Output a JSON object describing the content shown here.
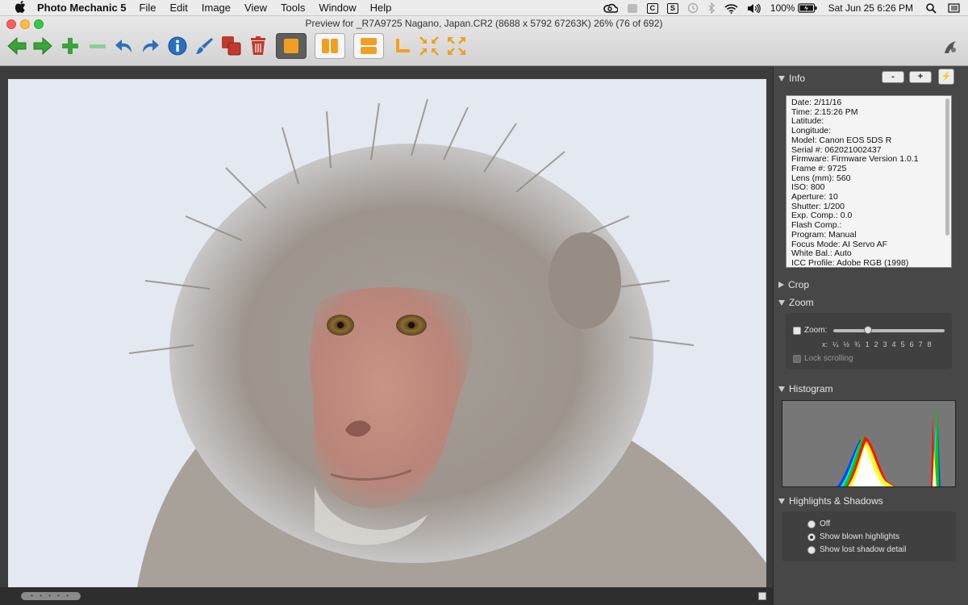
{
  "menubar": {
    "app_name": "Photo Mechanic 5",
    "menus": [
      "File",
      "Edit",
      "Image",
      "View",
      "Tools",
      "Window",
      "Help"
    ],
    "battery": "100%",
    "clock": "Sat Jun 25  6:26 PM",
    "tray_c": "C",
    "tray_s": "S"
  },
  "window": {
    "title": "Preview for _R7A9725 Nagano, Japan.CR2 (8688 x 5792 67263K) 26% (76 of 692)"
  },
  "toolbar": {
    "icons": [
      "back-arrow-icon",
      "forward-arrow-icon",
      "add-icon",
      "remove-icon",
      "rotate-left-icon",
      "rotate-right-icon",
      "info-icon",
      "edit-brush-icon",
      "copy-icon",
      "trash-icon",
      "single-view-icon",
      "side-by-side-icon",
      "stacked-view-icon",
      "crop-corner-icon",
      "shrink-icon",
      "expand-icon"
    ],
    "accent_colors": {
      "green": "#3aa33a",
      "blue": "#2a6fc0",
      "orange": "#f0a020",
      "red": "#c0392b"
    }
  },
  "sidepanel": {
    "info": {
      "heading": "Info",
      "btn_minus": "-",
      "btn_plus": "+",
      "btn_action": "⚡",
      "lines": [
        "Date: 2/11/16",
        "Time: 2:15:26 PM",
        "Latitude:",
        "Longitude:",
        "Model: Canon EOS 5DS R",
        "Serial #: 062021002437",
        "Firmware: Firmware Version 1.0.1",
        "Frame #: 9725",
        "Lens (mm): 560",
        "ISO: 800",
        "Aperture: 10",
        "Shutter: 1/200",
        "Exp. Comp.: 0.0",
        "Flash Comp.:",
        "Program: Manual",
        "Focus Mode: AI Servo AF",
        "White Bal.: Auto",
        "ICC Profile: Adobe RGB (1998)"
      ]
    },
    "crop": {
      "heading": "Crop"
    },
    "zoom": {
      "heading": "Zoom",
      "checkbox_label": "Zoom:",
      "scale": [
        "x:",
        "¼",
        "½",
        "¾",
        "1",
        "2",
        "3",
        "4",
        "5",
        "6",
        "7",
        "8"
      ],
      "slider_value_index": 3,
      "lock_label": "Lock scrolling"
    },
    "histogram": {
      "heading": "Histogram"
    },
    "highlights": {
      "heading": "Highlights & Shadows",
      "options": [
        "Off",
        "Show blown highlights",
        "Show lost shadow detail"
      ],
      "selected": 1
    }
  },
  "statusbar": {
    "pill": "• • • • •"
  }
}
